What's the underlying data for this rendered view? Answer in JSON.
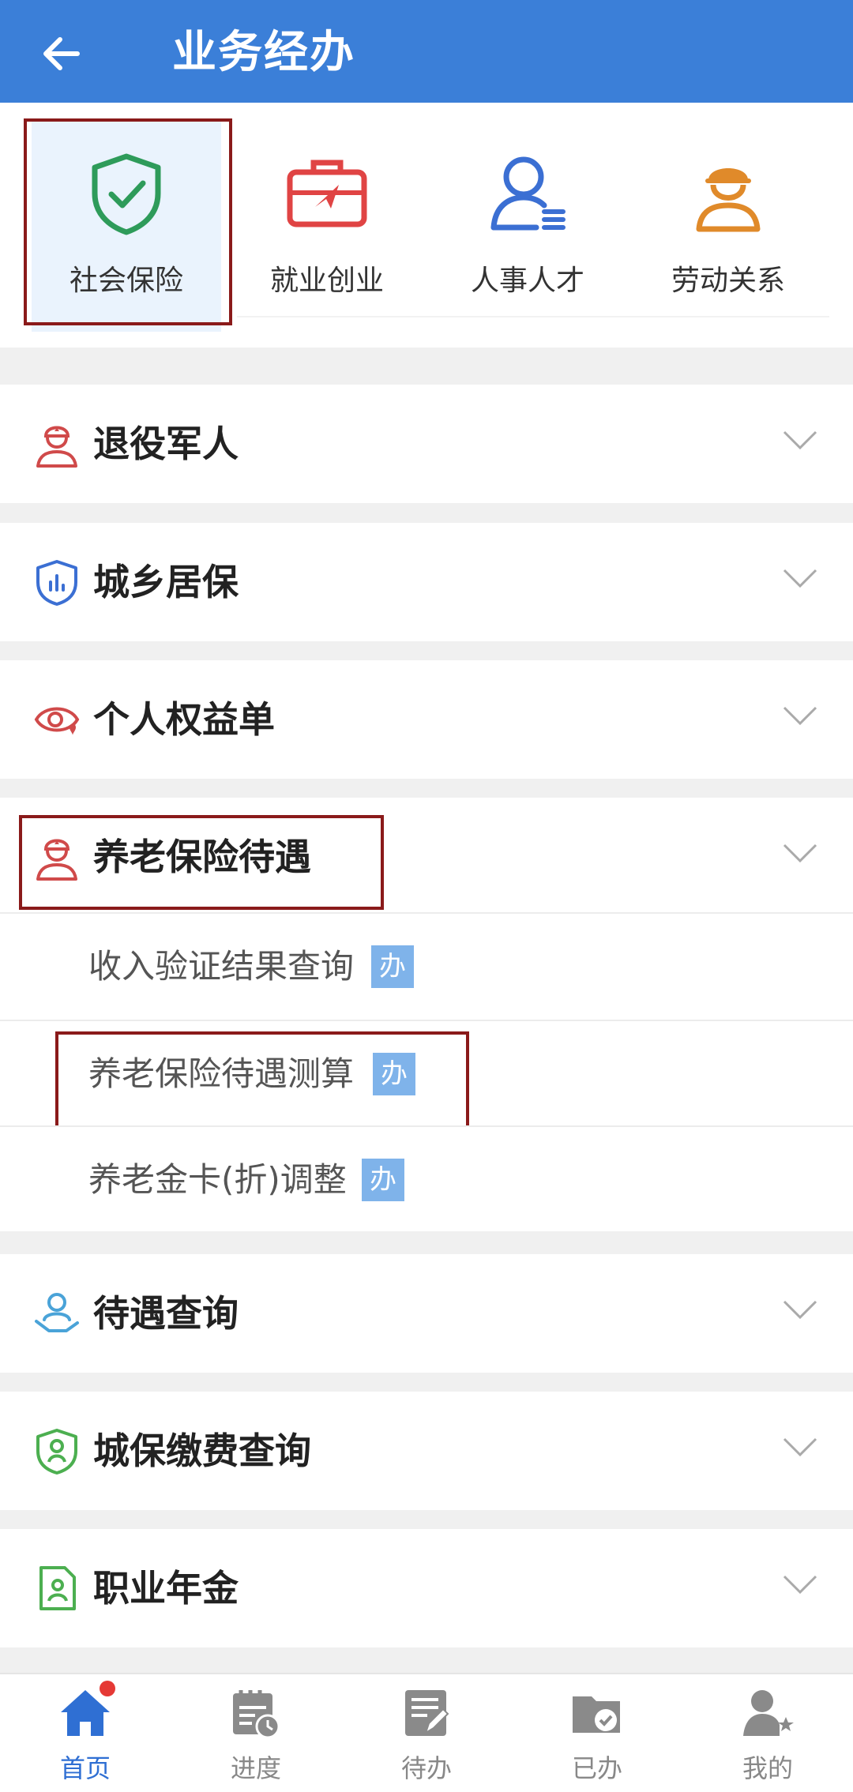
{
  "header": {
    "title": "业务经办",
    "back_icon": "arrow-left-icon"
  },
  "categories": [
    {
      "label": "社会保险",
      "icon": "shield-check-icon",
      "selected": true,
      "color": "#2e9b5a"
    },
    {
      "label": "就业创业",
      "icon": "briefcase-icon",
      "selected": false,
      "color": "#e04444"
    },
    {
      "label": "人事人才",
      "icon": "person-list-icon",
      "selected": false,
      "color": "#3b6fd3"
    },
    {
      "label": "劳动关系",
      "icon": "worker-helmet-icon",
      "selected": false,
      "color": "#e08a2a"
    }
  ],
  "sections": [
    {
      "label": "退役军人",
      "icon": "soldier-icon"
    },
    {
      "label": "城乡居保",
      "icon": "shield-chart-icon"
    },
    {
      "label": "个人权益单",
      "icon": "eye-heart-icon"
    },
    {
      "label": "养老保险待遇",
      "icon": "soldier-icon",
      "expanded": true,
      "items": [
        {
          "label": "收入验证结果查询",
          "badge": "办"
        },
        {
          "label": "养老保险待遇测算",
          "badge": "办"
        },
        {
          "label": "养老金卡(折)调整",
          "badge": "办"
        }
      ]
    },
    {
      "label": "待遇查询",
      "icon": "hand-person-icon"
    },
    {
      "label": "城保缴费查询",
      "icon": "shield-person-icon"
    },
    {
      "label": "职业年金",
      "icon": "document-person-icon"
    }
  ],
  "nav": [
    {
      "label": "首页",
      "icon": "home-icon",
      "active": true,
      "has_dot": true
    },
    {
      "label": "进度",
      "icon": "calendar-clock-icon",
      "active": false
    },
    {
      "label": "待办",
      "icon": "document-pen-icon",
      "active": false
    },
    {
      "label": "已办",
      "icon": "folder-check-icon",
      "active": false
    },
    {
      "label": "我的",
      "icon": "user-star-icon",
      "active": false
    }
  ],
  "colors": {
    "header": "#3b7fd8",
    "accent": "#2f6fd3",
    "highlight": "#8a1a1a",
    "badge": "#7fb3ea"
  }
}
